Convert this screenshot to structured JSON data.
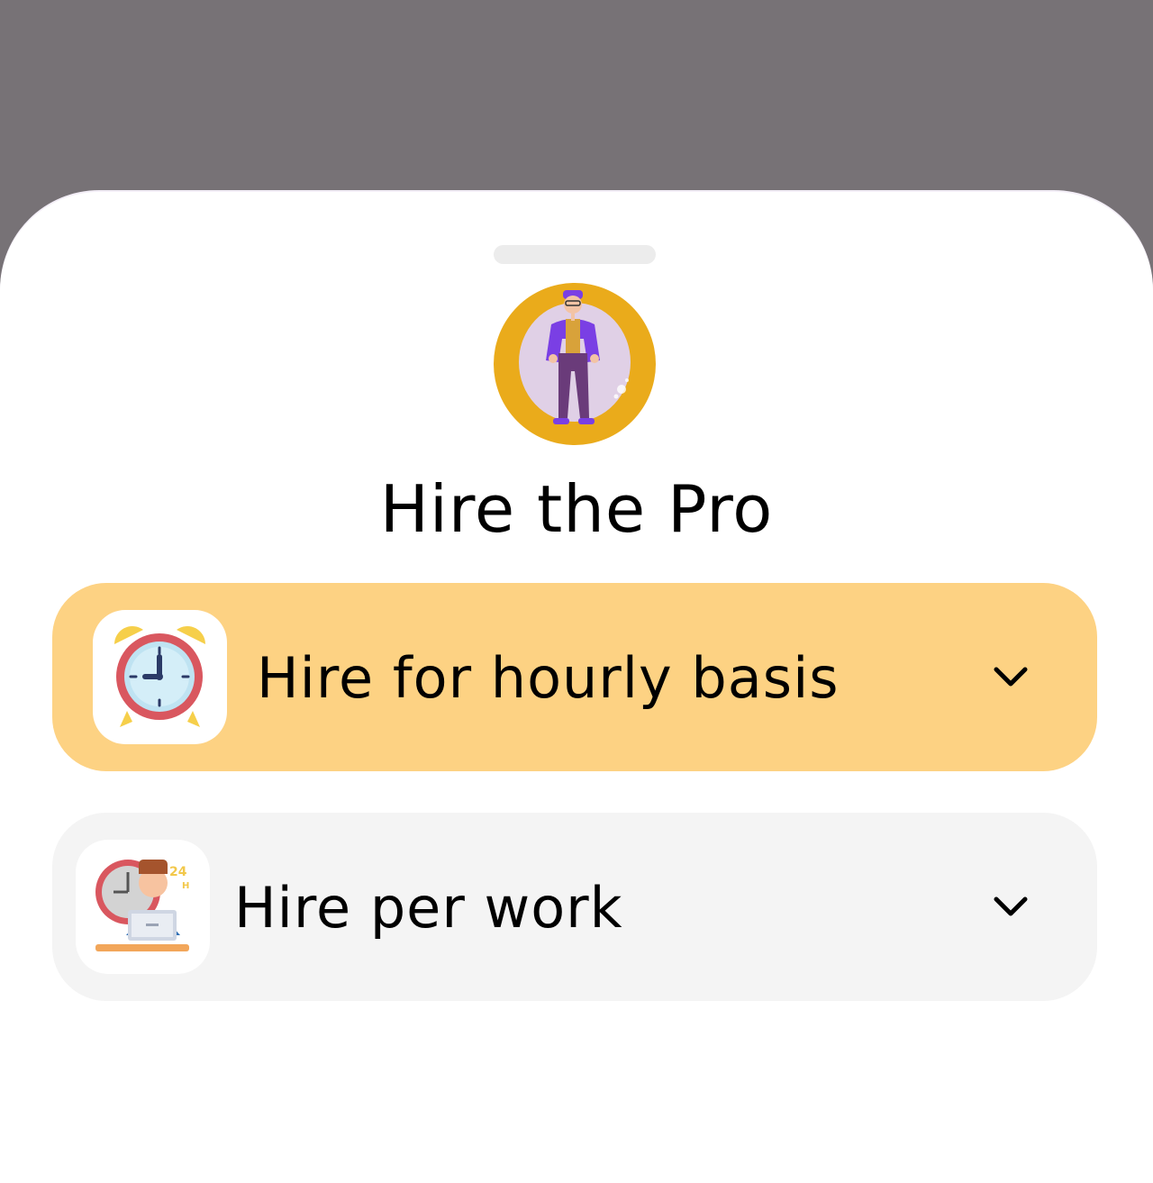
{
  "sheet": {
    "title": "Hire the Pro",
    "avatar_icon": "person-standing-illustration"
  },
  "options": [
    {
      "label": "Hire for hourly basis",
      "icon": "alarm-clock-icon",
      "selected": true,
      "background": "#fdd283",
      "chevron_icon": "chevron-down-icon"
    },
    {
      "label": "Hire per work",
      "icon": "person-at-computer-icon",
      "selected": false,
      "background": "#f4f4f4",
      "chevron_icon": "chevron-down-icon"
    }
  ],
  "colors": {
    "overlay": "#777276",
    "sheet": "#ffffff",
    "avatar_bg": "#eaab1b",
    "accent_purple": "#7a3fe4"
  }
}
